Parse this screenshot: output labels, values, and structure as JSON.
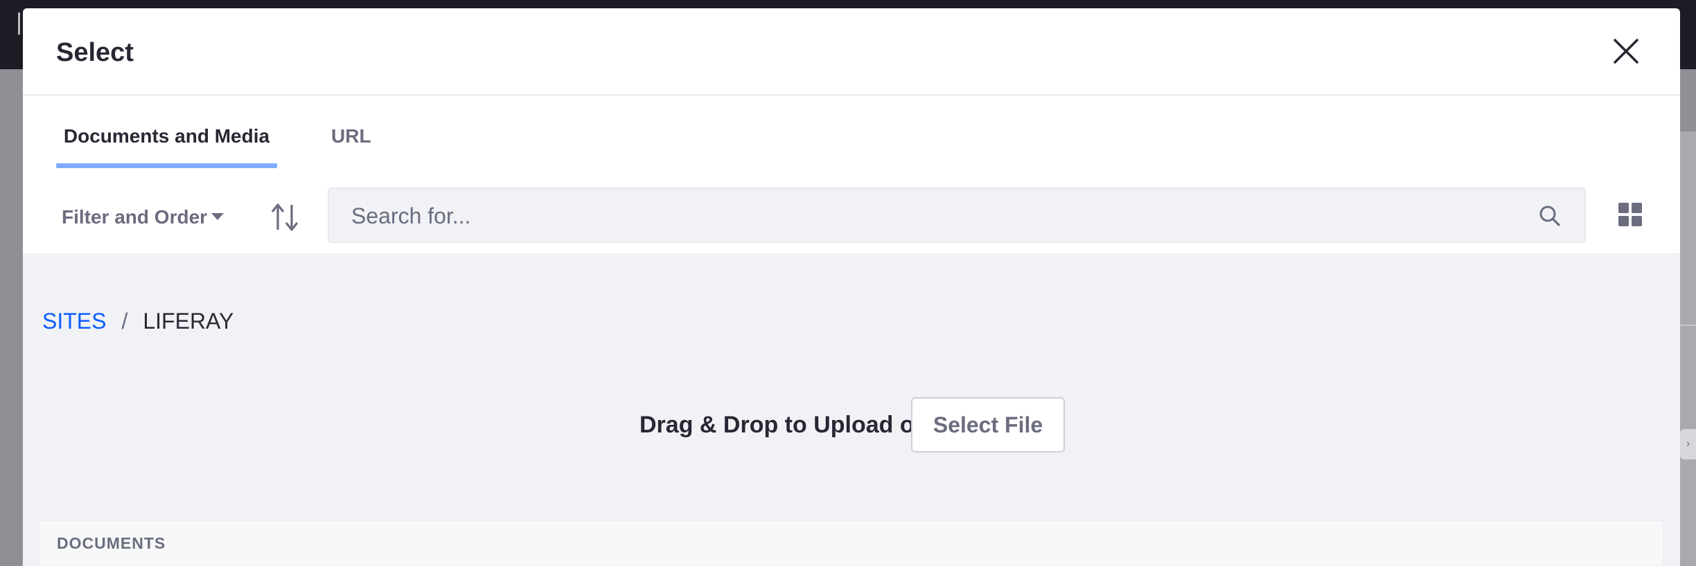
{
  "modal": {
    "title": "Select"
  },
  "tabs": [
    {
      "label": "Documents and Media",
      "active": true
    },
    {
      "label": "URL",
      "active": false
    }
  ],
  "toolbar": {
    "filter_label": "Filter and Order",
    "search_placeholder": "Search for..."
  },
  "breadcrumb": {
    "items": [
      "SITES",
      "LIFERAY"
    ],
    "separator": "/"
  },
  "upload": {
    "text": "Drag & Drop to Upload or",
    "button_label": "Select File"
  },
  "section": {
    "title": "DOCUMENTS"
  },
  "colors": {
    "accent": "#0b5fff",
    "tab_underline": "#80acff",
    "text_primary": "#272833",
    "text_secondary": "#6b6c7e",
    "content_background": "#f1f2f5"
  },
  "icons": {
    "close": "close-icon",
    "sort": "sort-arrows-icon",
    "search": "search-icon",
    "view": "grid-view-icon",
    "dropdown": "caret-down-icon"
  }
}
